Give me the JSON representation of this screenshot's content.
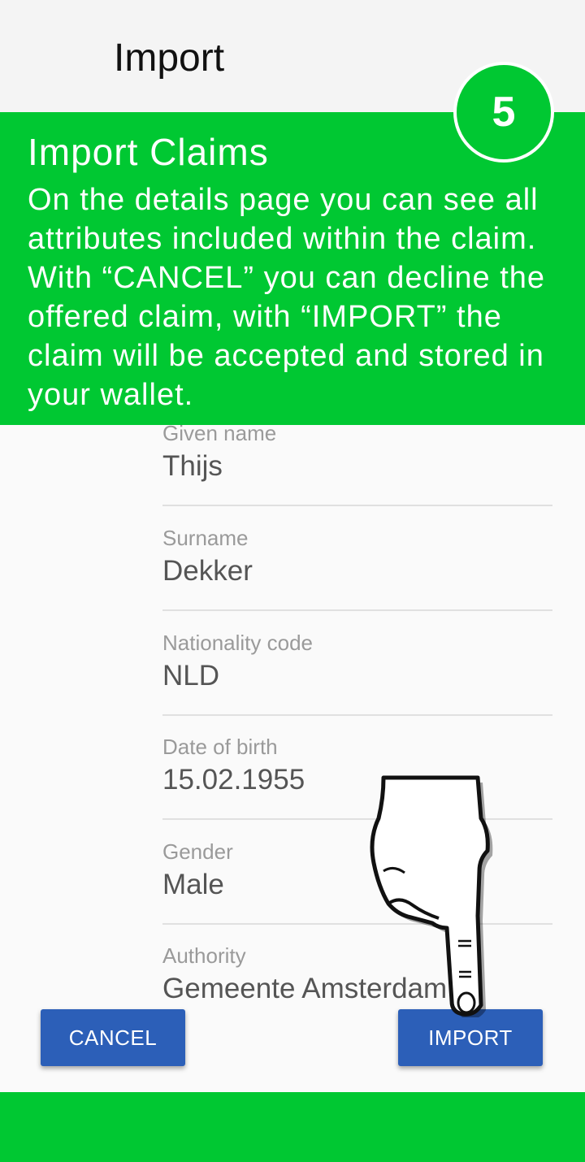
{
  "app_bar": {
    "title": "Import"
  },
  "tutorial": {
    "step": "5",
    "title": "Import Claims",
    "body": "On the details page you can see all attributes included within the claim. With “CANCEL” you can decline the offered claim, with “IMPORT” the claim will be accepted and stored in your wallet."
  },
  "fields": [
    {
      "label": "Given name",
      "value": "Thijs"
    },
    {
      "label": "Surname",
      "value": "Dekker"
    },
    {
      "label": "Nationality code",
      "value": "NLD"
    },
    {
      "label": "Date of birth",
      "value": "15.02.1955"
    },
    {
      "label": "Gender",
      "value": "Male"
    },
    {
      "label": "Authority",
      "value": "Gemeente Amsterdam"
    }
  ],
  "actions": {
    "cancel_label": "CANCEL",
    "import_label": "IMPORT"
  },
  "colors": {
    "overlay": "#00c832",
    "button": "#2c5fb8"
  },
  "icons": [
    "pointing-hand-icon"
  ]
}
